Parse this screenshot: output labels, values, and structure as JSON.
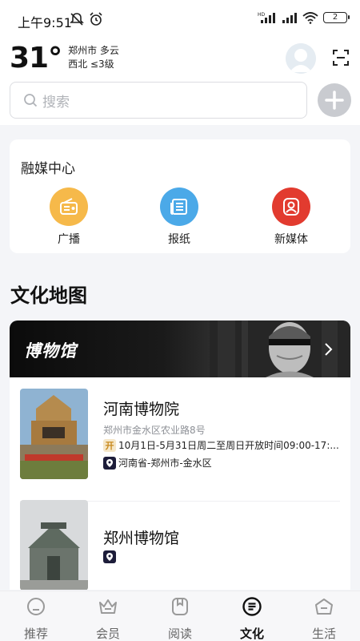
{
  "status_bar": {
    "time": "上午9:51",
    "battery": "2"
  },
  "weather": {
    "temperature": "31°",
    "location_condition": "郑州市 多云",
    "wind": "西北 ≤3级"
  },
  "search": {
    "placeholder": "搜索"
  },
  "media_center": {
    "title": "融媒中心",
    "items": [
      {
        "label": "广播",
        "icon": "radio-icon",
        "color": "#f6b94a"
      },
      {
        "label": "报纸",
        "icon": "newspaper-icon",
        "color": "#4ba9e8"
      },
      {
        "label": "新媒体",
        "icon": "new-media-icon",
        "color": "#e23b2f"
      }
    ]
  },
  "culture_map": {
    "title": "文化地图",
    "banner_title": "博物馆",
    "museums": [
      {
        "name": "河南博物院",
        "address": "郑州市金水区农业路8号",
        "hours_badge": "开",
        "hours": "10月1日-5月31日周二至周日开放时间09:00-17:...",
        "region": "河南省-郑州市-金水区"
      },
      {
        "name": "郑州博物馆"
      }
    ]
  },
  "tabbar": {
    "tabs": [
      {
        "label": "推荐",
        "icon": "recommend-icon",
        "active": false
      },
      {
        "label": "会员",
        "icon": "crown-icon",
        "active": false
      },
      {
        "label": "阅读",
        "icon": "read-icon",
        "active": false
      },
      {
        "label": "文化",
        "icon": "culture-icon",
        "active": true
      },
      {
        "label": "生活",
        "icon": "life-icon",
        "active": false
      }
    ]
  }
}
